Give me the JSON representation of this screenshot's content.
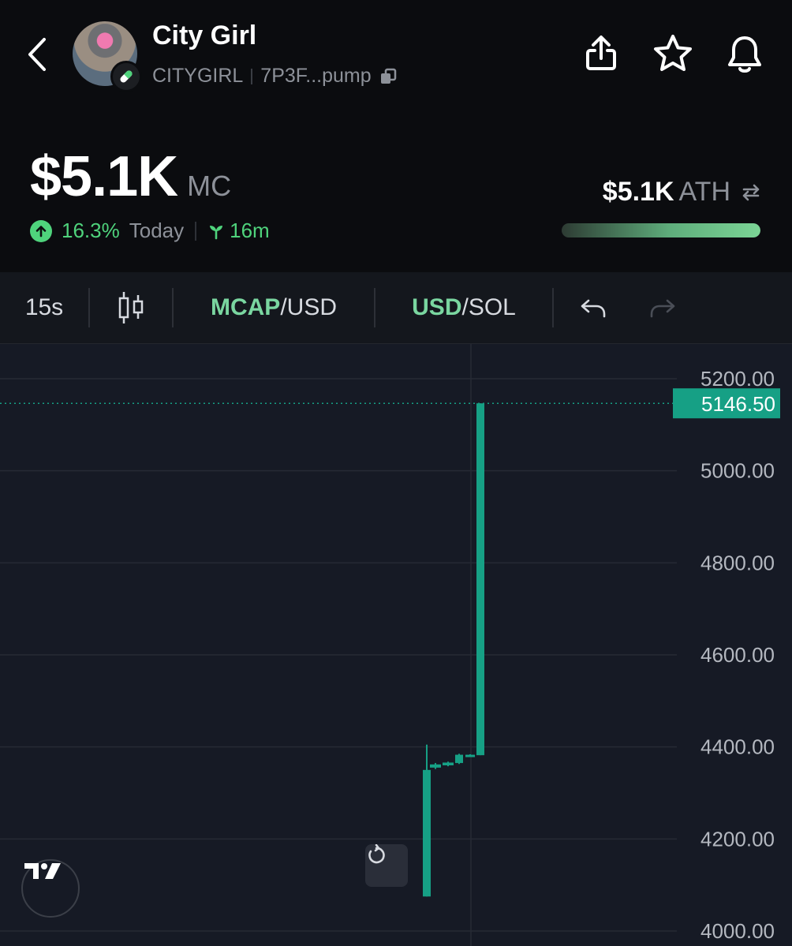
{
  "header": {
    "token_name": "City Girl",
    "ticker": "CITYGIRL",
    "address": "7P3F...pump",
    "market_cap": "$5.1K",
    "market_cap_unit": "MC",
    "change_pct": "16.3%",
    "change_period": "Today",
    "age": "16m",
    "ath_value": "$5.1K",
    "ath_label": "ATH",
    "ath_progress": 1.0,
    "icons": [
      "back-chevron-icon",
      "pill-icon",
      "copy-icon",
      "share-icon",
      "star-icon",
      "bell-icon",
      "arrow-up-circle-icon",
      "sprout-icon",
      "swap-icon"
    ]
  },
  "toolbar": {
    "interval": "15s",
    "chart_type_icon": "candles-icon",
    "mcap_label": "MCAP",
    "mcap_unit": "/USD",
    "usd_label": "USD",
    "usd_unit": "/SOL",
    "undo_icon": "undo-icon",
    "redo_icon": "redo-icon"
  },
  "colors": {
    "accent_green": "#4fd37c",
    "candle_up": "#16a085",
    "chart_bg": "#161a25"
  },
  "chart_data": {
    "type": "candlestick",
    "y_ticks": [
      "5200.00",
      "5000.00",
      "4800.00",
      "4600.00",
      "4400.00",
      "4200.00",
      "4000.00"
    ],
    "ylim": [
      3995,
      5280
    ],
    "last_price": "5146.50",
    "candles": [
      {
        "open": 4075,
        "high": 4405,
        "low": 4075,
        "close": 4350
      },
      {
        "open": 4355,
        "high": 4365,
        "low": 4352,
        "close": 4362
      },
      {
        "open": 4360,
        "high": 4368,
        "low": 4358,
        "close": 4366
      },
      {
        "open": 4365,
        "high": 4385,
        "low": 4363,
        "close": 4383
      },
      {
        "open": 4380,
        "high": 4384,
        "low": 4379,
        "close": 4383
      },
      {
        "open": 4382,
        "high": 5146.5,
        "low": 4382,
        "close": 5146.5
      }
    ]
  },
  "tradingview_logo": "TV"
}
